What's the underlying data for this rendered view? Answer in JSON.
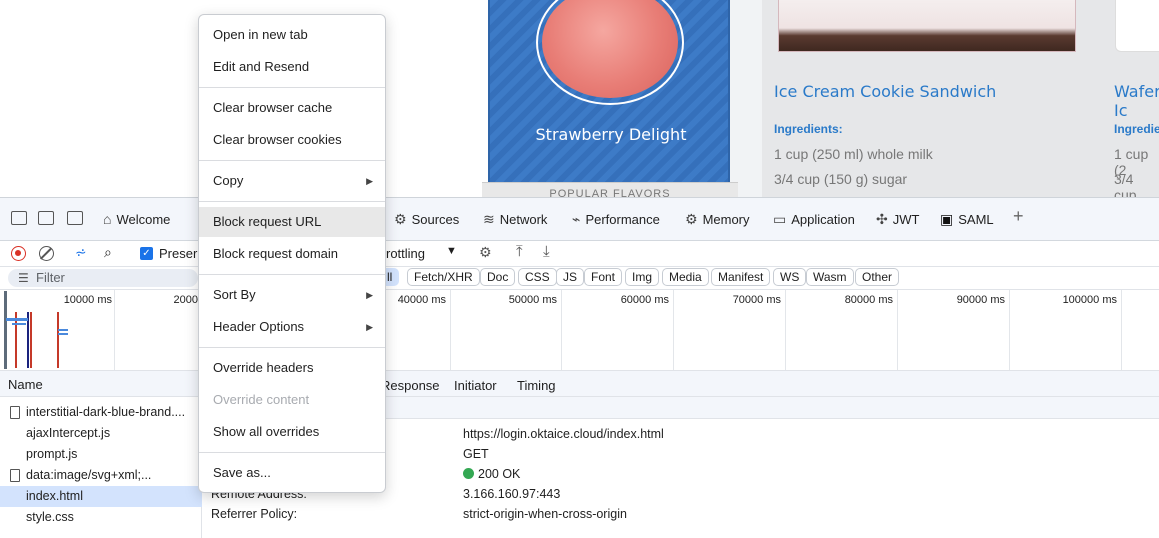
{
  "website": {
    "card_title": "Strawberry Delight",
    "popular_label": "POPULAR FLAVORS",
    "products": [
      {
        "title": "Ice Cream Cookie Sandwich",
        "ingredients_label": "Ingredients:",
        "lines": [
          "1 cup (250 ml) whole milk",
          "3/4 cup (150 g) sugar"
        ]
      },
      {
        "title": "Wafer Ic",
        "ingredients_label": "Ingredier",
        "lines": [
          "1 cup (2",
          "3/4 cup"
        ]
      }
    ]
  },
  "devtools": {
    "tabs": [
      {
        "label": "Welcome",
        "icon": "home-icon"
      },
      {
        "label": "Sources",
        "icon": "sources-icon"
      },
      {
        "label": "Network",
        "icon": "wifi-icon"
      },
      {
        "label": "Performance",
        "icon": "performance-icon"
      },
      {
        "label": "Memory",
        "icon": "memory-icon"
      },
      {
        "label": "Application",
        "icon": "application-icon"
      },
      {
        "label": "JWT",
        "icon": "puzzle-icon"
      },
      {
        "label": "SAML",
        "icon": "saml-icon"
      }
    ],
    "toolbar": {
      "preserve_label": "Preser",
      "throttling_label": "rottling"
    },
    "filter": {
      "placeholder": "Filter",
      "chips": [
        "ll",
        "Fetch/XHR",
        "Doc",
        "CSS",
        "JS",
        "Font",
        "Img",
        "Media",
        "Manifest",
        "WS",
        "Wasm",
        "Other"
      ]
    },
    "timeline_labels": [
      "10000 ms",
      "2000",
      "40000 ms",
      "50000 ms",
      "60000 ms",
      "70000 ms",
      "80000 ms",
      "90000 ms",
      "100000 ms"
    ],
    "table": {
      "name_header": "Name",
      "detail_tabs": [
        "Response",
        "Initiator",
        "Timing"
      ]
    },
    "files": [
      {
        "name": "interstitial-dark-blue-brand....",
        "doc": true
      },
      {
        "name": "ajaxIntercept.js",
        "doc": false
      },
      {
        "name": "prompt.js",
        "doc": false
      },
      {
        "name": "data:image/svg+xml;...",
        "doc": true
      },
      {
        "name": "index.html",
        "doc": false,
        "selected": true
      },
      {
        "name": "style.css",
        "doc": false
      }
    ],
    "headers": {
      "url": "https://login.oktaice.cloud/index.html",
      "method": "GET",
      "status": "200 OK",
      "remote_address_label": "Remote Address:",
      "remote_address": "3.166.160.97:443",
      "referrer_label": "Referrer Policy:",
      "referrer": "strict-origin-when-cross-origin"
    }
  },
  "context_menu": {
    "items": [
      {
        "label": "Open in new tab"
      },
      {
        "label": "Edit and Resend"
      },
      {
        "label": "Clear browser cache"
      },
      {
        "label": "Clear browser cookies"
      },
      {
        "label": "Copy",
        "submenu": true
      },
      {
        "label": "Block request URL",
        "hover": true
      },
      {
        "label": "Block request domain"
      },
      {
        "label": "Sort By",
        "submenu": true
      },
      {
        "label": "Header Options",
        "submenu": true
      },
      {
        "label": "Override headers"
      },
      {
        "label": "Override content",
        "disabled": true
      },
      {
        "label": "Show all overrides"
      },
      {
        "label": "Save as..."
      }
    ]
  }
}
